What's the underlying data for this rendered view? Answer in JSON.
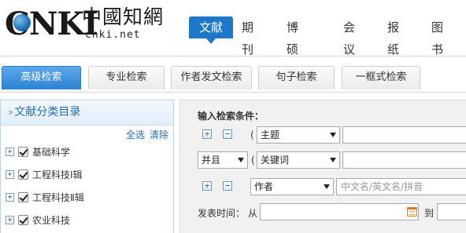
{
  "logo": {
    "latin": "CNKI",
    "chinese": "中國知網",
    "url": "cnki.net"
  },
  "nav": {
    "tabs": [
      {
        "label": "文献",
        "active": true
      },
      {
        "label": "期刊",
        "active": false
      },
      {
        "label": "博硕士",
        "active": false
      },
      {
        "label": "会议",
        "active": false
      },
      {
        "label": "报纸",
        "active": false
      },
      {
        "label": "图书",
        "active": false
      }
    ]
  },
  "search_types": [
    {
      "label": "高级检索",
      "active": true
    },
    {
      "label": "专业检索",
      "active": false
    },
    {
      "label": "作者发文检索",
      "active": false
    },
    {
      "label": "句子检索",
      "active": false
    },
    {
      "label": "一框式检索",
      "active": false
    }
  ],
  "sidebar": {
    "chevron": "»",
    "title": "文献分类目录",
    "select_all": "全选",
    "clear": "清除",
    "items": [
      {
        "label": "基础科学",
        "checked": true
      },
      {
        "label": "工程科技Ⅰ辑",
        "checked": true
      },
      {
        "label": "工程科技Ⅱ辑",
        "checked": true
      },
      {
        "label": "农业科技",
        "checked": true
      }
    ]
  },
  "form": {
    "title": "输入检索条件：",
    "plus": "+",
    "minus": "−",
    "paren": "(",
    "row1": {
      "field": "主题",
      "value": ""
    },
    "row2": {
      "logic": "并且",
      "field": "关键词",
      "value": ""
    },
    "row3": {
      "field": "作者",
      "placeholder": "中文名/英文名/拼音"
    },
    "date": {
      "label": "发表时间：",
      "from": "从",
      "to": "到"
    }
  },
  "colors": {
    "accent": "#1f77c9",
    "tab_active": "#2c82d3",
    "sidebar_title": "#1f6db5"
  }
}
